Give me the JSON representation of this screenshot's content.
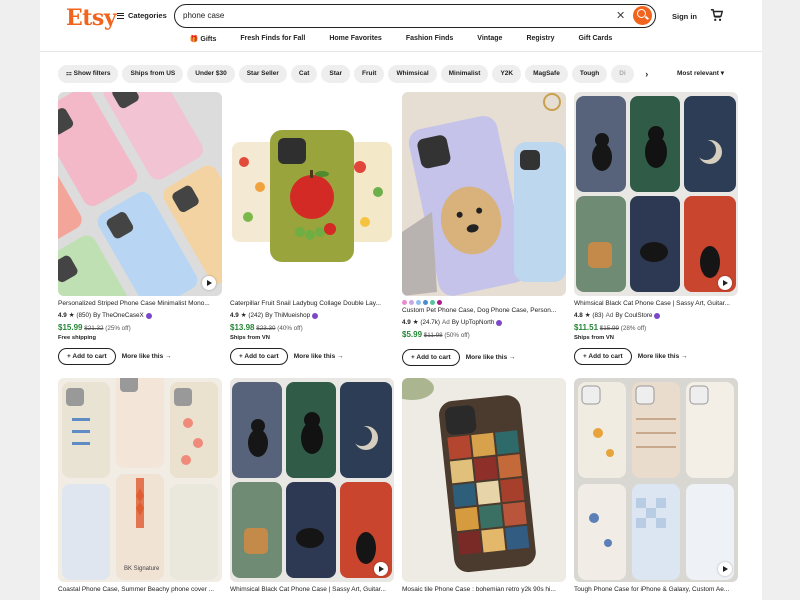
{
  "header": {
    "logo": "Etsy",
    "categories_label": "Categories",
    "search_value": "phone case",
    "signin_label": "Sign in"
  },
  "nav": [
    "Gifts",
    "Fresh Finds for Fall",
    "Home Favorites",
    "Fashion Finds",
    "Vintage",
    "Registry",
    "Gift Cards"
  ],
  "filters": {
    "show_filters": "Show filters",
    "chips": [
      "Ships from US",
      "Under $30",
      "Star Seller",
      "Cat",
      "Star",
      "Fruit",
      "Whimsical",
      "Minimalist",
      "Y2K",
      "MagSafe",
      "Tough"
    ],
    "faded_chip": "Di",
    "sort_label": "Most relevant"
  },
  "colors": {
    "accent": "#f1641e",
    "price_green": "#258635"
  },
  "cards": [
    {
      "title": "Personalized Striped Phone Case Minimalist Mono...",
      "rating": "4.9",
      "reviews": "(850)",
      "shop": "By TheOneCaseX",
      "price": "$15.99",
      "original": "$21.32",
      "discount": "(25% off)",
      "shipping": "Free shipping",
      "add": "Add to cart",
      "more": "More like this →"
    },
    {
      "title": "Caterpillar Fruit Snail Ladybug Collage Double Lay...",
      "rating": "4.9",
      "reviews": "(242)",
      "shop": "By ThiMueishop",
      "price": "$13.98",
      "original": "$23.30",
      "discount": "(40% off)",
      "shipping": "Ships from VN",
      "add": "Add to cart",
      "more": "More like this →"
    },
    {
      "title": "Custom Pet Phone Case, Dog Phone Case, Person...",
      "rating": "4.9",
      "reviews": "(24.7k)",
      "ad": "Ad",
      "shop": "By UpTopNorth",
      "price": "$5.99",
      "original": "$11.98",
      "discount": "(50% off)",
      "shipping": "Ships from VN",
      "add": "Add to cart",
      "more": "More like this →"
    },
    {
      "title": "Whimsical Black Cat Phone Case | Sassy Art, Guitar...",
      "rating": "4.8",
      "reviews": "(83)",
      "ad": "Ad",
      "shop": "By CoulStore",
      "price": "$11.51",
      "original": "$15.99",
      "discount": "(28% off)",
      "shipping": "Ships from VN",
      "add": "Add to cart",
      "more": "More like this →"
    },
    {
      "title": "Coastal Phone Case, Summer Beachy phone cover ...",
      "signature": "BK Signature"
    },
    {
      "title": "Whimsical Black Cat Phone Case | Sassy Art, Guitar..."
    },
    {
      "title": "Mosaic tile Phone Case : bohemian retro y2k 90s hi..."
    },
    {
      "title": "Tough Phone Case for iPhone & Galaxy, Custom Ae..."
    }
  ],
  "swatch_colors": [
    "#e98ccf",
    "#c9a6e8",
    "#8ec1f0",
    "#4a8bd8",
    "#5bc39d",
    "#b01a8e"
  ]
}
